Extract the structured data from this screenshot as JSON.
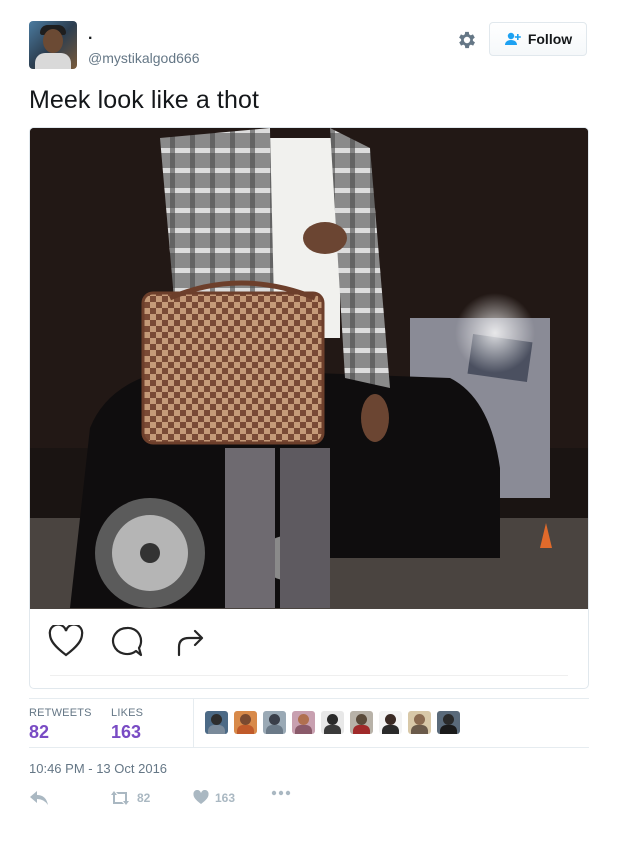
{
  "tweet": {
    "display_name": ".",
    "handle": "@mystikalgod666",
    "text": "Meek look like a thot",
    "timestamp": "10:46 PM - 13 Oct 2016"
  },
  "header": {
    "follow_label": "Follow",
    "gear_icon": "gear-icon",
    "follow_icon": "add-user-icon"
  },
  "media_actions": {
    "like_icon": "heart-outline-icon",
    "comment_icon": "comment-bubble-icon",
    "share_icon": "share-arrow-icon"
  },
  "stats": {
    "retweets_label": "RETWEETS",
    "retweets_value": "82",
    "likes_label": "LIKES",
    "likes_value": "163",
    "liker_avatar_count": 9
  },
  "actions": {
    "reply_icon": "reply-icon",
    "retweet_icon": "retweet-icon",
    "retweet_count": "82",
    "like_icon": "heart-icon",
    "like_count": "163",
    "more_icon": "more-dots-icon"
  },
  "colors": {
    "stat_value": "#794bc4",
    "muted": "#657786",
    "icon_muted": "#aab8c2",
    "follow_blue": "#1da1f2"
  }
}
